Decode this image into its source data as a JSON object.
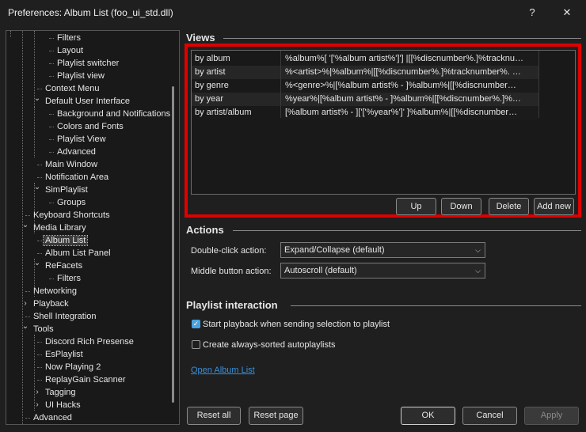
{
  "window": {
    "title": "Preferences: Album List (foo_ui_std.dll)",
    "help_glyph": "?",
    "close_glyph": "✕"
  },
  "tree": {
    "items": [
      {
        "label": "Filters",
        "selected": false
      },
      {
        "label": "Layout",
        "selected": false
      },
      {
        "label": "Playlist switcher",
        "selected": false
      },
      {
        "label": "Playlist view",
        "selected": false
      },
      {
        "label": "Context Menu",
        "selected": false
      },
      {
        "label": "Default User Interface",
        "selected": false,
        "expanded": true
      },
      {
        "label": "Background and Notifications",
        "selected": false
      },
      {
        "label": "Colors and Fonts",
        "selected": false
      },
      {
        "label": "Playlist View",
        "selected": false
      },
      {
        "label": "Advanced",
        "selected": false
      },
      {
        "label": "Main Window",
        "selected": false
      },
      {
        "label": "Notification Area",
        "selected": false
      },
      {
        "label": "SimPlaylist",
        "selected": false,
        "expanded": true
      },
      {
        "label": "Groups",
        "selected": false
      },
      {
        "label": "Keyboard Shortcuts",
        "selected": false
      },
      {
        "label": "Media Library",
        "selected": false,
        "expanded": true
      },
      {
        "label": "Album List",
        "selected": true
      },
      {
        "label": "Album List Panel",
        "selected": false
      },
      {
        "label": "ReFacets",
        "selected": false,
        "expanded": true
      },
      {
        "label": "Filters",
        "selected": false
      },
      {
        "label": "Networking",
        "selected": false
      },
      {
        "label": "Playback",
        "selected": false,
        "expanded": false
      },
      {
        "label": "Shell Integration",
        "selected": false
      },
      {
        "label": "Tools",
        "selected": false,
        "expanded": true
      },
      {
        "label": "Discord Rich Presense",
        "selected": false
      },
      {
        "label": "EsPlaylist",
        "selected": false
      },
      {
        "label": "Now Playing 2",
        "selected": false
      },
      {
        "label": "ReplayGain Scanner",
        "selected": false
      },
      {
        "label": "Tagging",
        "selected": false,
        "expanded": false
      },
      {
        "label": "UI Hacks",
        "selected": false,
        "expanded": false
      },
      {
        "label": "Advanced",
        "selected": false
      }
    ]
  },
  "views": {
    "section_title": "Views",
    "rows": [
      {
        "name": "by album",
        "pattern": "%album%[ '['%album artist%']'] |[[%discnumber%.]%tracknu…"
      },
      {
        "name": "by artist",
        "pattern": "%<artist>%|%album%|[[%discnumber%.]%tracknumber%. …"
      },
      {
        "name": "by genre",
        "pattern": "%<genre>%|[%album artist% - ]%album%|[[%discnumber…"
      },
      {
        "name": "by year",
        "pattern": "%year%|[%album artist% - ]%album%|[[%discnumber%.]%…"
      },
      {
        "name": "by artist/album",
        "pattern": "[%album artist% - ]['['%year%']' ]%album%|[[%discnumber…"
      }
    ],
    "buttons": {
      "up": "Up",
      "down": "Down",
      "delete": "Delete",
      "add_new": "Add new"
    }
  },
  "actions": {
    "section_title": "Actions",
    "double_click_label": "Double-click action:",
    "double_click_value": "Expand/Collapse (default)",
    "middle_button_label": "Middle button action:",
    "middle_button_value": "Autoscroll (default)"
  },
  "playlist_interaction": {
    "section_title": "Playlist interaction",
    "start_playback_label": "Start playback when sending selection to playlist",
    "start_playback_checked": true,
    "always_sorted_label": "Create always-sorted autoplaylists",
    "always_sorted_checked": false,
    "open_link": "Open Album List"
  },
  "footer": {
    "reset_all": "Reset all",
    "reset_page": "Reset page",
    "ok": "OK",
    "cancel": "Cancel",
    "apply": "Apply"
  }
}
